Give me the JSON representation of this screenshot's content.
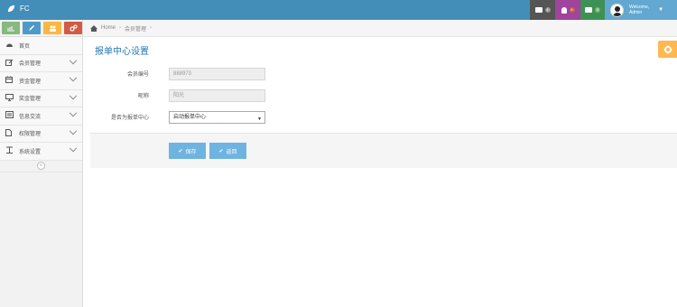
{
  "app": {
    "brand": "FC"
  },
  "topbar": {
    "tasks_badge": "4",
    "notifications_badge": "8",
    "messages_badge": "5",
    "user_greeting": "Welcome,",
    "user_name": "Admin",
    "colors": {
      "bar": "#438eb9",
      "tasks": "#555555",
      "notifications": "#a0449c",
      "messages": "#3e9154",
      "user": "#62a8d1"
    }
  },
  "shortcuts": [
    {
      "icon": "chart-icon",
      "color": "#87b87f"
    },
    {
      "icon": "pencil-icon",
      "color": "#4f99c6"
    },
    {
      "icon": "users-icon",
      "color": "#fbb543"
    },
    {
      "icon": "cogs-icon",
      "color": "#d15b47"
    }
  ],
  "sidebar": {
    "items": [
      {
        "label": "首页",
        "icon": "dashboard-icon",
        "has_arrow": false
      },
      {
        "label": "会员管理",
        "icon": "edit-icon",
        "has_arrow": true
      },
      {
        "label": "资金管理",
        "icon": "calendar-icon",
        "has_arrow": true
      },
      {
        "label": "奖金管理",
        "icon": "desktop-icon",
        "has_arrow": true
      },
      {
        "label": "信息交流",
        "icon": "list-alt-icon",
        "has_arrow": true
      },
      {
        "label": "权限管理",
        "icon": "file-icon",
        "has_arrow": true
      },
      {
        "label": "系统设置",
        "icon": "text-width-icon",
        "has_arrow": true
      }
    ],
    "collapse_glyph": "«"
  },
  "breadcrumb": {
    "home": "Home",
    "current": "会员管理"
  },
  "page": {
    "title": "报单中心设置",
    "settings_icon": "gear-icon"
  },
  "form": {
    "member_no_label": "会员编号",
    "member_no_value": "888973",
    "nickname_label": "昵称",
    "nickname_value": "阳光",
    "report_center_label": "是否为报单中心",
    "report_center_value": "启动报单中心"
  },
  "actions": {
    "save_label": "保存",
    "back_label": "返回"
  }
}
